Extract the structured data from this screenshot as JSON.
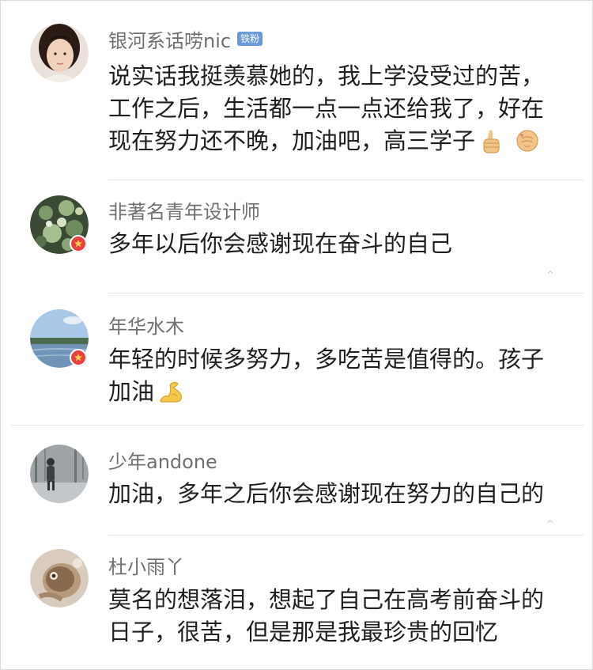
{
  "comments": [
    {
      "username": "银河系话唠nic",
      "badge": "铁粉",
      "lines": [
        "说实话我挺羡慕她的，我上学没受过的苦，",
        "工作之后，生活都一点一点还给我了，好在",
        "现在努力还不晚，加油吧，高三学子"
      ],
      "emoji": [
        "thumbs-up",
        "fist-bump"
      ],
      "verified": false
    },
    {
      "username": "非著名青年设计师",
      "lines": [
        "多年以后你会感谢现在奋斗的自己"
      ],
      "verified": true
    },
    {
      "username": "年华水木",
      "lines": [
        "年轻的时候多努力，多吃苦是值得的。孩子",
        "加油"
      ],
      "emoji": [
        "flexed-biceps"
      ],
      "verified": true
    },
    {
      "username": "少年andone",
      "lines": [
        "加油，多年之后你会感谢现在努力的自己的"
      ],
      "verified": false
    },
    {
      "username": "杜小雨丫",
      "lines": [
        "莫名的想落泪，想起了自己在高考前奋斗的",
        "日子，很苦，但是那是我最珍贵的回忆"
      ],
      "verified": false
    }
  ],
  "colors": {
    "username": "#6f6f6f",
    "text": "#1f1f1f",
    "fan_badge": "#6a9ad8",
    "verified_badge": "#e8413f",
    "divider": "#e6e6e6"
  }
}
